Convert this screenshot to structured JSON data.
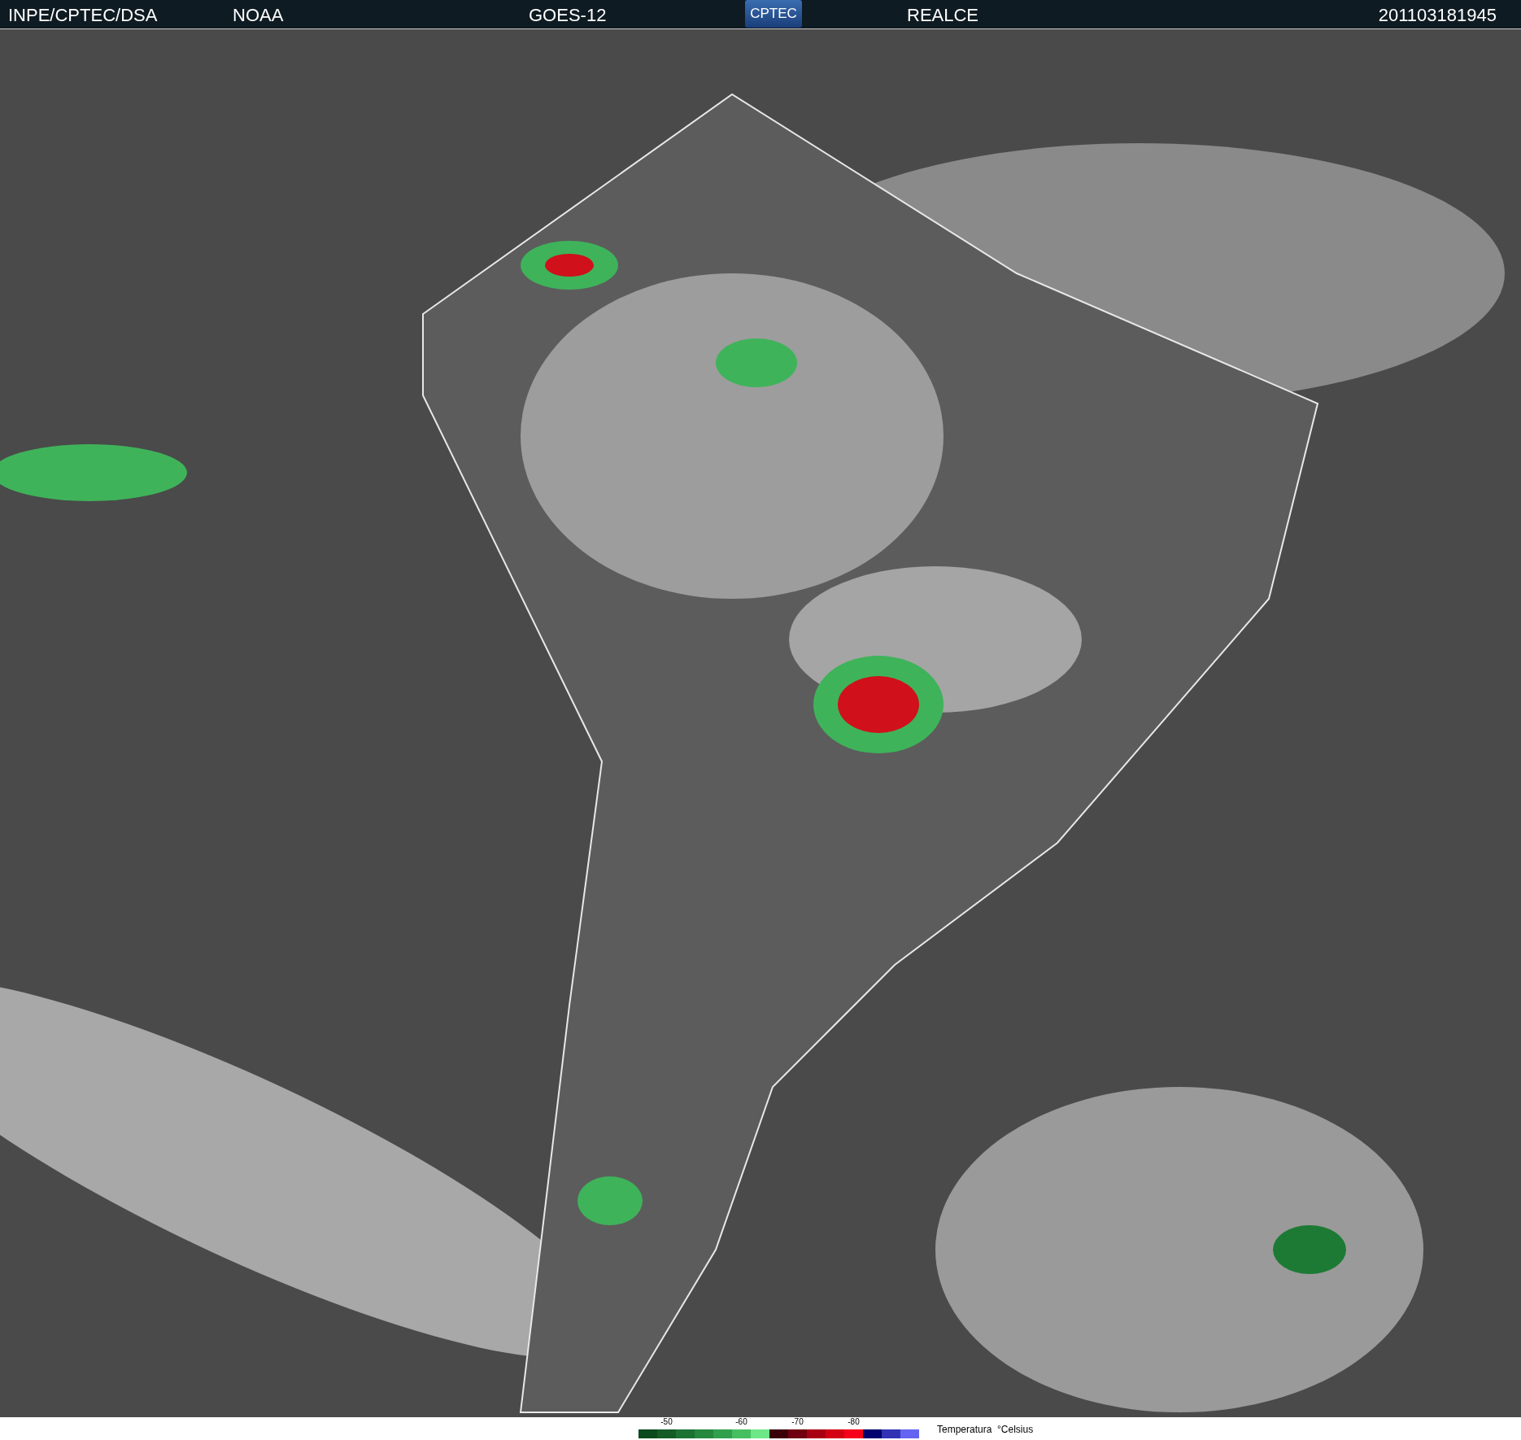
{
  "header": {
    "source": "INPE/CPTEC/DSA",
    "agency": "NOAA",
    "satellite": "GOES-12",
    "logo": "CPTEC",
    "product": "REALCE",
    "timestamp": "201103181945"
  },
  "legend": {
    "title": "Temperatura  °Celsius",
    "swatches": [
      {
        "color": "#0b4a1c"
      },
      {
        "color": "#135c26",
        "label": "-50"
      },
      {
        "color": "#1c7232"
      },
      {
        "color": "#26883e"
      },
      {
        "color": "#31a04c"
      },
      {
        "color": "#45bf60",
        "label": "-60"
      },
      {
        "color": "#6ee887"
      },
      {
        "color": "#3a0008"
      },
      {
        "color": "#70000f",
        "label": "-70"
      },
      {
        "color": "#a80012"
      },
      {
        "color": "#d30014"
      },
      {
        "color": "#f50018",
        "label": "-80"
      },
      {
        "color": "#00006e"
      },
      {
        "color": "#3232b4"
      },
      {
        "color": "#6464f2"
      }
    ]
  }
}
